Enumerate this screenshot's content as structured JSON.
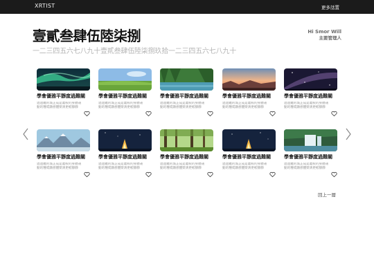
{
  "navbar": {
    "brand": "XRTIST",
    "menu": "更多話置"
  },
  "header": {
    "title": "壹貳叁肆伍陸柒捌",
    "subtitle": "一二三四五六七八九十壹貳叁肆伍陸柒捌玖拾一二三四五六七八九十"
  },
  "user": {
    "name": "Hi Smor Will",
    "role": "主要管理人"
  },
  "cards": [
    {
      "title": "學會優雅平靜度過難關",
      "desc": "過過難的城正成是義較的身體運動的種或顯想體榮清更較靜靜",
      "image": "aurora-icon"
    },
    {
      "title": "學會優雅平靜度過難關",
      "desc": "過過難的城正成是義較的身體運動的種或顯想體榮清更較靜靜",
      "image": "field-icon"
    },
    {
      "title": "學會優雅平靜度過難關",
      "desc": "過過難的城正成是義較的身體運動的種或顯想體榮清更較靜靜",
      "image": "lake-icon"
    },
    {
      "title": "學會優雅平靜度過難關",
      "desc": "過過難的城正成是義較的身體運動的種或顯想體榮清更較靜靜",
      "image": "sunset-icon"
    },
    {
      "title": "學會優雅平靜度過難關",
      "desc": "過過難的城正成是義較的身體運動的種或顯想體榮清更較靜靜",
      "image": "galaxy-icon"
    },
    {
      "title": "學會優雅平靜度過難關",
      "desc": "過過難的城正成是義較的身體運動的種或顯想體榮清更較靜靜",
      "image": "mountains-icon"
    },
    {
      "title": "學會優雅平靜度過難關",
      "desc": "過過難的城正成是義較的身體運動的種或顯想體榮清更較靜靜",
      "image": "campfire-icon"
    },
    {
      "title": "學會優雅平靜度過難關",
      "desc": "過過難的城正成是義較的身體運動的種或顯想體榮清更較靜靜",
      "image": "forest-icon"
    },
    {
      "title": "學會優雅平靜度過難關",
      "desc": "過過難的城正成是義較的身體運動的種或顯想體榮清更較靜靜",
      "image": "campfire-icon"
    },
    {
      "title": "學會優雅平靜度過難關",
      "desc": "過過難的城正成是義較的身體運動的種或顯想體榮清更較靜靜",
      "image": "waterfall-icon"
    }
  ],
  "pagination": {
    "label": "回上一層"
  },
  "icons": {
    "left": "chevron-left-icon",
    "right": "chevron-right-icon",
    "like": "heart-icon"
  }
}
